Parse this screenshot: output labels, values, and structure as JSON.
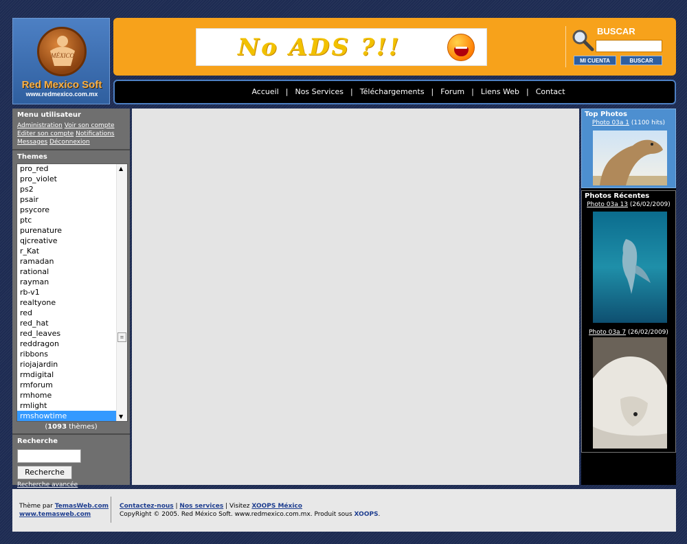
{
  "header": {
    "logo_name": "Red Mexico Soft",
    "logo_url": "www.redmexico.com.mx",
    "logo_badge": "MÉXICO",
    "banner_text": "No ADS ?!!",
    "search_title": "BUSCAR",
    "search_value": "",
    "account_button": "MI CUENTA",
    "search_button": "BUSCAR"
  },
  "nav": {
    "items": [
      "Accueil",
      "Nos Services",
      "Téléchargements",
      "Forum",
      "Liens Web",
      "Contact"
    ],
    "separator": "|"
  },
  "user_menu": {
    "title": "Menu utilisateur",
    "links": [
      "Administration",
      "Voir son compte",
      "Editer son compte",
      "Notifications",
      "Messages",
      "Déconnexion"
    ]
  },
  "themes": {
    "title": "Themes",
    "items": [
      "pro_red",
      "pro_violet",
      "ps2",
      "psair",
      "psycore",
      "ptc",
      "purenature",
      "qjcreative",
      "r_Kat",
      "ramadan",
      "rational",
      "rayman",
      "rb-v1",
      "realtyone",
      "red",
      "red_hat",
      "red_leaves",
      "reddragon",
      "ribbons",
      "riojajardin",
      "rmdigital",
      "rmforum",
      "rmhome",
      "rmlight",
      "rmshowtime"
    ],
    "selected": "rmshowtime",
    "count": "1093",
    "count_suffix": " thèmes)",
    "count_prefix": "("
  },
  "search_block": {
    "title": "Recherche",
    "input_value": "",
    "button": "Recherche",
    "advanced": "Recherche avancée"
  },
  "top_photos": {
    "title": "Top Photos",
    "caption_link": "Photo 03a 1",
    "caption_info": " (1100 hits)"
  },
  "recent_photos": {
    "title": "Photos Récentes",
    "items": [
      {
        "link": "Photo 03a 13",
        "info": " (26/02/2009)"
      },
      {
        "link": "Photo 03a 7",
        "info": " (26/02/2009)"
      }
    ]
  },
  "footer": {
    "theme_by": "Thème par ",
    "theme_link": "TemasWeb.com",
    "theme_url": "www.temasweb.com",
    "contact": "Contactez-nous",
    "services": "Nos services",
    "visit": " Visitez ",
    "xoops_mexico": "XOOPS México",
    "copyright": "CopyRight © 2005. Red México Soft. www.redmexico.com.mx. Produit sous ",
    "xoops": "XOOPS"
  },
  "colors": {
    "accent_orange": "#f7a21b",
    "accent_blue": "#4d80c4",
    "background": "#1d2b52",
    "selected": "#3399ff"
  }
}
